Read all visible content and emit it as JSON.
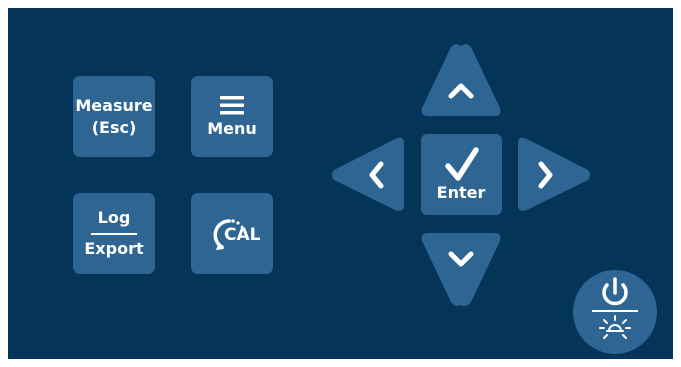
{
  "keypad": {
    "measure": {
      "line1": "Measure",
      "line2": "(Esc)"
    },
    "menu": {
      "label": "Menu",
      "icon": "hamburger-icon"
    },
    "log_export": {
      "top": "Log",
      "bottom": "Export"
    },
    "cal": {
      "label": "CAL",
      "icon": "calibrate-arrow-icon"
    },
    "enter": {
      "label": "Enter",
      "icon": "checkmark-icon"
    },
    "up": {
      "icon": "chevron-up-icon"
    },
    "down": {
      "icon": "chevron-down-icon"
    },
    "left": {
      "icon": "chevron-left-icon"
    },
    "right": {
      "icon": "chevron-right-icon"
    },
    "power": {
      "icon": "power-icon",
      "secondary_icon": "backlight-icon"
    }
  },
  "colors": {
    "panel_bg": "#043458",
    "key_bg": "#2e6593",
    "key_text": "#ffffff"
  }
}
